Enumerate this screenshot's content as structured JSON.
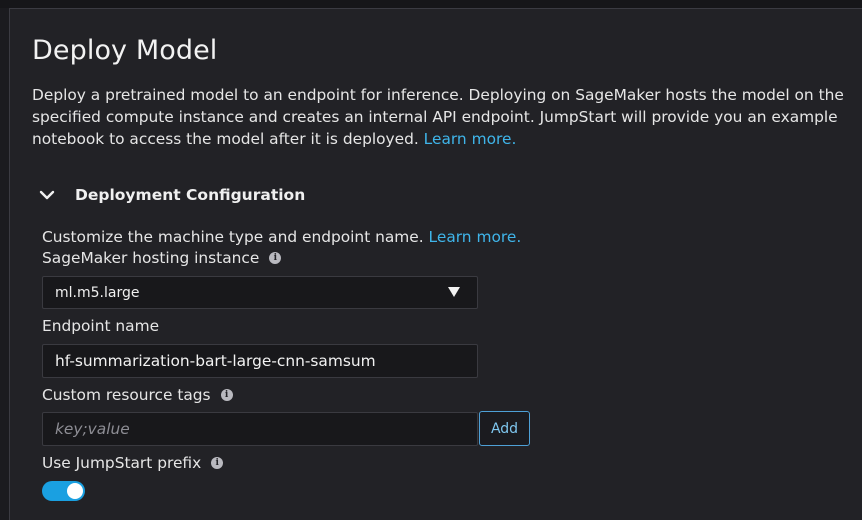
{
  "page": {
    "title": "Deploy Model",
    "description": "Deploy a pretrained model to an endpoint for inference. Deploying on SageMaker hosts the model on the specified compute instance and creates an internal API endpoint. JumpStart will provide you an example notebook to access the model after it is deployed. ",
    "learn_more": "Learn more."
  },
  "deployment_config": {
    "section_title": "Deployment Configuration",
    "expanded": true,
    "description": "Customize the machine type and endpoint name. ",
    "learn_more": "Learn more.",
    "hosting_instance": {
      "label": "SageMaker hosting instance",
      "selected": "ml.m5.large"
    },
    "endpoint_name": {
      "label": "Endpoint name",
      "value": "hf-summarization-bart-large-cnn-samsum"
    },
    "resource_tags": {
      "label": "Custom resource tags",
      "placeholder": "key;value",
      "add_label": "Add"
    },
    "jumpstart_prefix": {
      "label": "Use JumpStart prefix",
      "enabled": true
    }
  },
  "icons": {
    "info": "i",
    "chevron": "chevron-down-icon"
  },
  "colors": {
    "background": "#222226",
    "link": "#3fb5ea",
    "toggle_on": "#1aa0e1",
    "button_border": "#4ea0d6"
  }
}
